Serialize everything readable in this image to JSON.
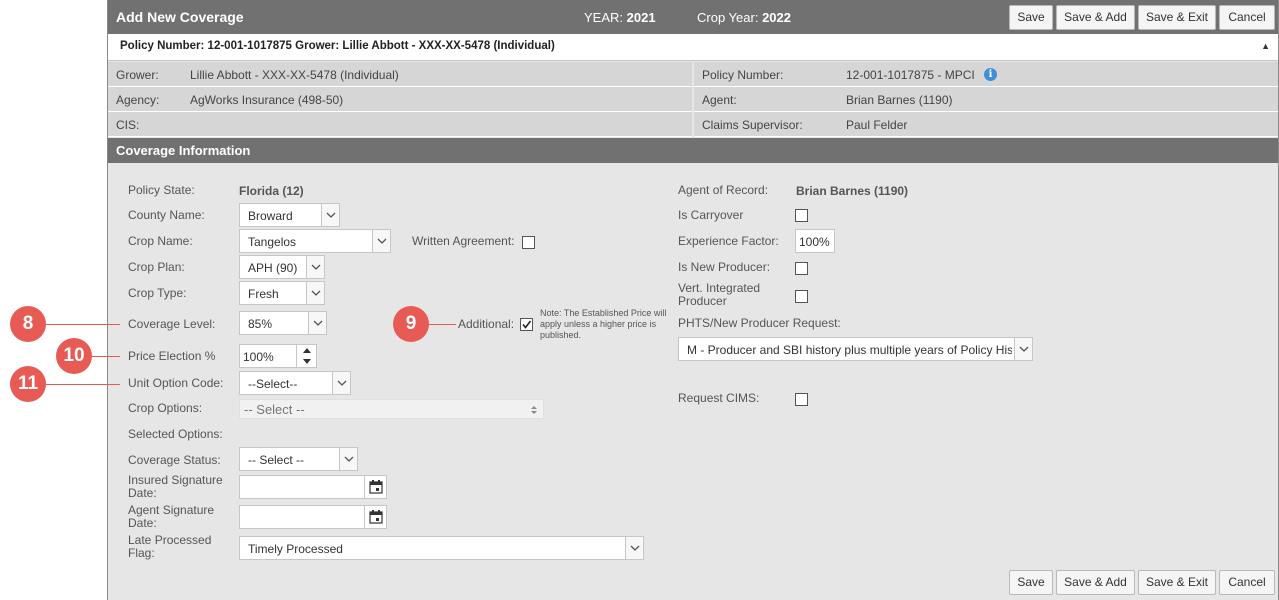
{
  "header": {
    "title": "Add New Coverage",
    "year_label": "YEAR:",
    "year_value": "2021",
    "crop_year_label": "Crop Year:",
    "crop_year_value": "2022"
  },
  "toolbar": {
    "save": "Save",
    "save_add": "Save & Add",
    "save_exit": "Save & Exit",
    "cancel": "Cancel"
  },
  "summary": "Policy Number: 12-001-1017875 Grower: Lillie Abbott - XXX-XX-5478 (Individual)",
  "summary_toggle": "▲",
  "info": {
    "grower_label": "Grower:",
    "grower_value": "Lillie Abbott - XXX-XX-5478 (Individual)",
    "agency_label": "Agency:",
    "agency_value": "AgWorks Insurance (498-50)",
    "cis_label": "CIS:",
    "cis_value": "",
    "policy_label": "Policy Number:",
    "policy_value": "12-001-1017875 - MPCI",
    "agent_label": "Agent:",
    "agent_value": "Brian Barnes (1190)",
    "claims_label": "Claims Supervisor:",
    "claims_value": "Paul Felder"
  },
  "section_title": "Coverage Information",
  "form": {
    "policy_state_label": "Policy State:",
    "policy_state_value": "Florida (12)",
    "county_label": "County Name:",
    "county_value": "Broward",
    "crop_name_label": "Crop Name:",
    "crop_name_value": "Tangelos",
    "written_agreement_label": "Written Agreement:",
    "crop_plan_label": "Crop Plan:",
    "crop_plan_value": "APH (90)",
    "crop_type_label": "Crop Type:",
    "crop_type_value": "Fresh",
    "coverage_level_label": "Coverage Level:",
    "coverage_level_value": "85%",
    "additional_label": "Additional:",
    "additional_note": "Note: The Established Price will apply unless a higher price is published.",
    "price_election_label": "Price Election %",
    "price_election_value": "100%",
    "unit_option_label": "Unit Option Code:",
    "unit_option_value": "--Select--",
    "crop_options_label": "Crop Options:",
    "crop_options_value": "-- Select --",
    "selected_options_label": "Selected Options:",
    "coverage_status_label": "Coverage Status:",
    "coverage_status_value": "-- Select --",
    "insured_sig_label_1": "Insured Signature",
    "insured_sig_label_2": "Date:",
    "agent_sig_label_1": "Agent Signature",
    "agent_sig_label_2": "Date:",
    "late_processed_label_1": "Late Processed",
    "late_processed_label_2": "Flag:",
    "late_processed_value": "Timely Processed",
    "agent_of_record_label": "Agent of Record:",
    "agent_of_record_value": "Brian Barnes (1190)",
    "is_carryover_label": "Is Carryover",
    "experience_factor_label": "Experience Factor:",
    "experience_factor_value": "100%",
    "is_new_producer_label": "Is New Producer:",
    "vert_integrated_label_1": "Vert. Integrated",
    "vert_integrated_label_2": "Producer",
    "phts_label": "PHTS/New Producer Request:",
    "phts_value": "M - Producer and SBI history plus multiple years of Policy His",
    "request_cims_label": "Request CIMS:"
  },
  "checkboxes": {
    "written_agreement": false,
    "additional": true,
    "is_carryover": false,
    "is_new_producer": false,
    "vert_integrated": false,
    "request_cims": false
  },
  "markers": {
    "m8": "8",
    "m9": "9",
    "m10": "10",
    "m11": "11"
  },
  "colors": {
    "header_bg": "#717171",
    "panel_bg": "#e6e6e6",
    "marker": "#e85b55",
    "info_icon": "#3d8fd6"
  }
}
